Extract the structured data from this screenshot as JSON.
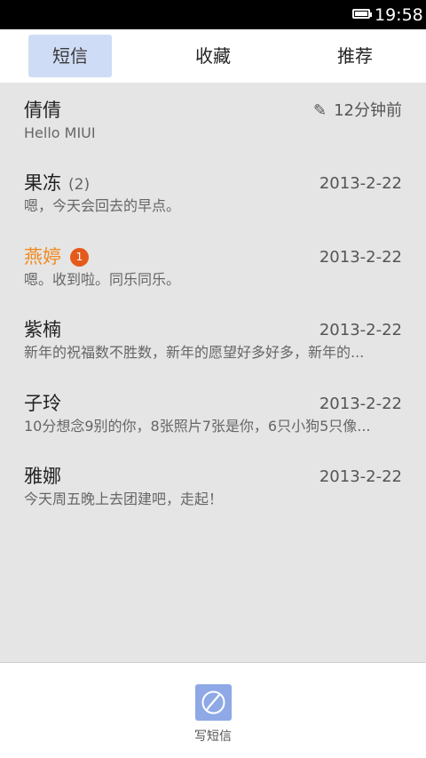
{
  "status_bar": {
    "time": "19:58",
    "battery_icon": "battery-full-icon"
  },
  "tabs": [
    {
      "label": "短信",
      "active": true
    },
    {
      "label": "收藏",
      "active": false
    },
    {
      "label": "推荐",
      "active": false
    }
  ],
  "conversations": [
    {
      "name": "倩倩",
      "count": "",
      "badge": "",
      "date": "12分钟前",
      "draft_icon": "pencil-icon",
      "preview": "Hello MIUI"
    },
    {
      "name": "果冻",
      "count": "(2)",
      "badge": "",
      "date": "2013-2-22",
      "preview": "嗯，今天会回去的早点。"
    },
    {
      "name": "燕婷",
      "count": "",
      "badge": "1",
      "date": "2013-2-22",
      "preview": "嗯。收到啦。同乐同乐。"
    },
    {
      "name": "紫楠",
      "count": "",
      "badge": "",
      "date": "2013-2-22",
      "preview": "新年的祝福数不胜数，新年的愿望好多好多，新年的..."
    },
    {
      "name": "子玲",
      "count": "",
      "badge": "",
      "date": "2013-2-22",
      "preview": "10分想念9别的你，8张照片7张是你，6只小狗5只像..."
    },
    {
      "name": "雅娜",
      "count": "",
      "badge": "",
      "date": "2013-2-22",
      "preview": "今天周五晚上去团建吧，走起！"
    }
  ],
  "bottom": {
    "compose_label": "写短信",
    "compose_icon": "compose-pencil-icon"
  },
  "colors": {
    "accent_unread": "#f08a22",
    "badge": "#e55a1a",
    "active_tab": "#cfdcf5",
    "compose": "#8fa9e6"
  }
}
